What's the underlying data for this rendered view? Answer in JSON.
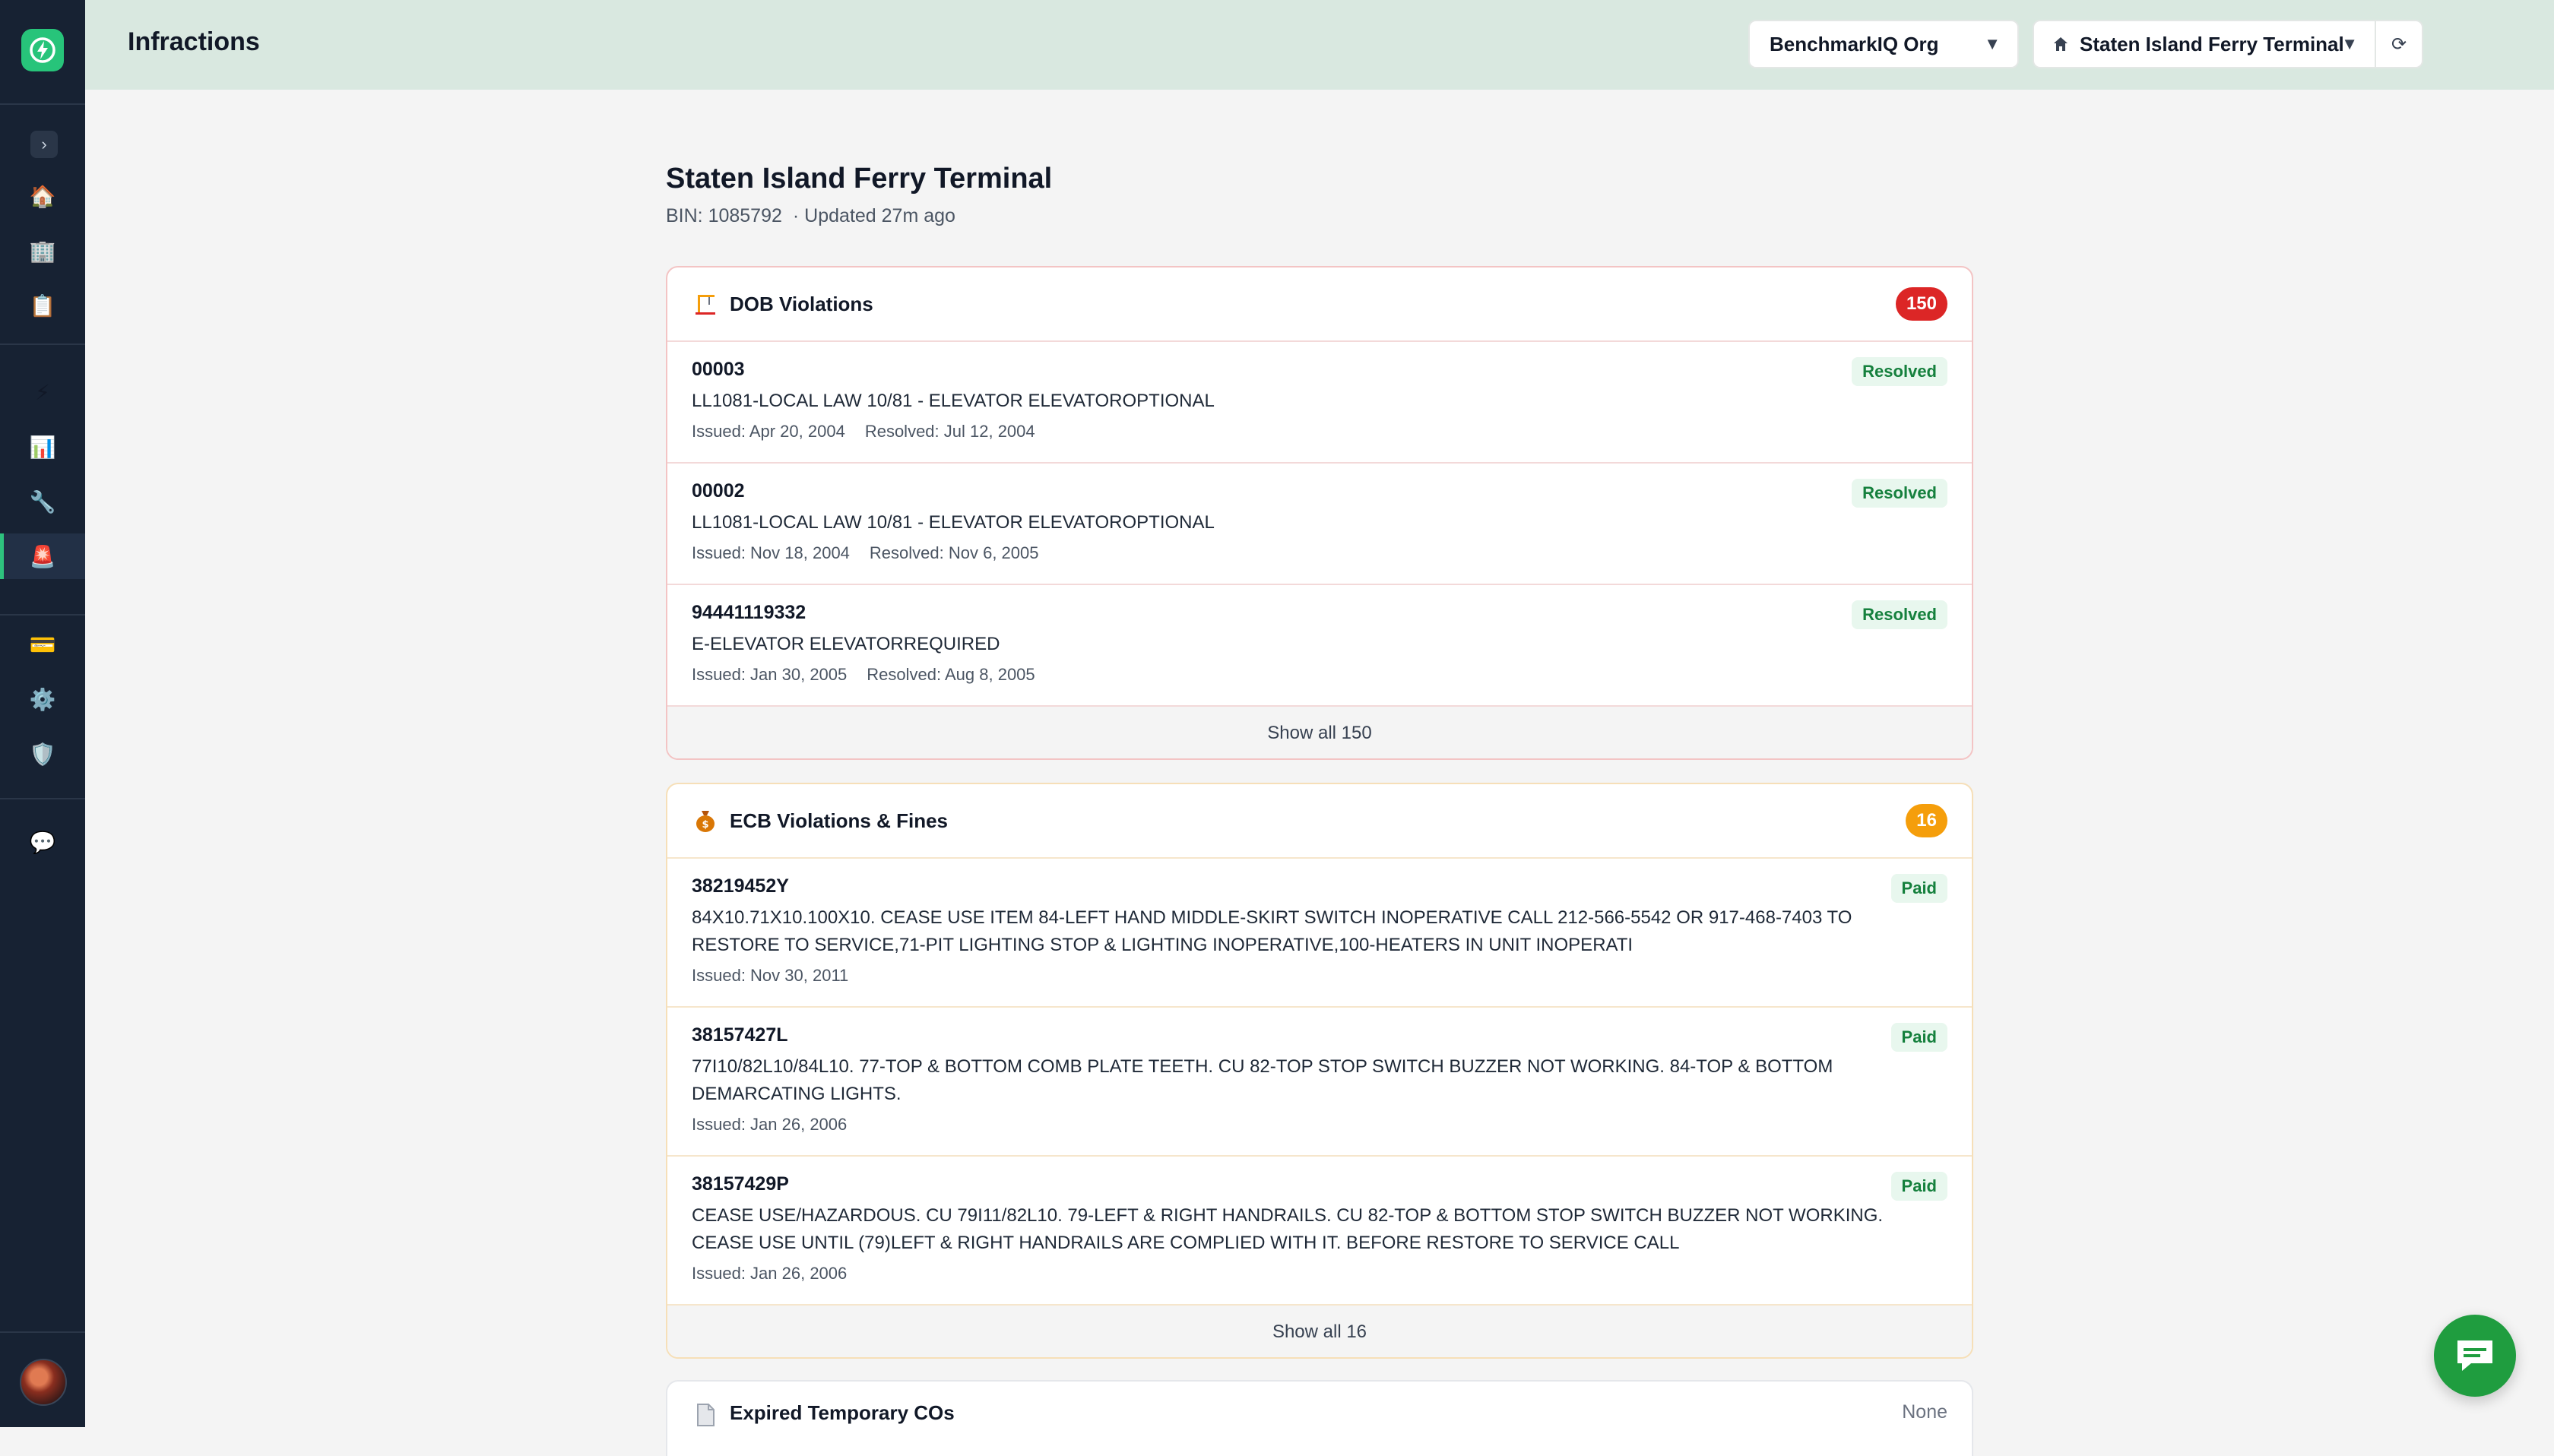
{
  "app": {
    "page_title": "Infractions",
    "org_select": "BenchmarkIQ Org",
    "site_select": "Staten Island Ferry Terminal",
    "refresh_icon": "⟳"
  },
  "sidebar": {
    "items": [
      {
        "name": "home-icon",
        "glyph": "🏠"
      },
      {
        "name": "buildings-icon",
        "glyph": "🏢"
      },
      {
        "name": "clipboard-icon",
        "glyph": "📋"
      },
      {
        "name": "energy-icon",
        "glyph": "⚡"
      },
      {
        "name": "analytics-icon",
        "glyph": "📊"
      },
      {
        "name": "tools-icon",
        "glyph": "🔧"
      },
      {
        "name": "infractions-icon",
        "glyph": "🚨"
      },
      {
        "name": "billing-icon",
        "glyph": "💳"
      },
      {
        "name": "settings-icon",
        "glyph": "⚙️"
      },
      {
        "name": "shield-icon",
        "glyph": "🛡️"
      },
      {
        "name": "chat-icon",
        "glyph": "💬"
      }
    ],
    "toggle": "›"
  },
  "building": {
    "name": "Staten Island Ferry Terminal",
    "bin": "BIN: 1085792",
    "updated": "· Updated 27m ago"
  },
  "dob": {
    "title": "DOB Violations",
    "count": "150",
    "rows": [
      {
        "id": "00003",
        "desc": "LL1081-LOCAL LAW 10/81 - ELEVATOR ELEVATOROPTIONAL",
        "issued": "Issued: Apr 20, 2004",
        "resolved": "Resolved: Jul 12, 2004",
        "status": "Resolved"
      },
      {
        "id": "00002",
        "desc": "LL1081-LOCAL LAW 10/81 - ELEVATOR ELEVATOROPTIONAL",
        "issued": "Issued: Nov 18, 2004",
        "resolved": "Resolved: Nov 6, 2005",
        "status": "Resolved"
      },
      {
        "id": "94441119332",
        "desc": "E-ELEVATOR ELEVATORREQUIRED",
        "issued": "Issued: Jan 30, 2005",
        "resolved": "Resolved: Aug 8, 2005",
        "status": "Resolved"
      }
    ],
    "show_all": "Show all 150"
  },
  "ecb": {
    "title": "ECB Violations & Fines",
    "count": "16",
    "rows": [
      {
        "id": "38219452Y",
        "desc": "84X10.71X10.100X10. CEASE USE ITEM 84-LEFT HAND MIDDLE-SKIRT SWITCH INOPERATIVE CALL 212-566-5542 OR 917-468-7403 TO RESTORE TO SERVICE,71-PIT LIGHTING STOP & LIGHTING INOPERATIVE,100-HEATERS IN UNIT INOPERATI",
        "issued": "Issued: Nov 30, 2011",
        "status": "Paid"
      },
      {
        "id": "38157427L",
        "desc": "77I10/82L10/84L10. 77-TOP & BOTTOM COMB PLATE TEETH. CU 82-TOP STOP SWITCH BUZZER NOT WORKING. 84-TOP & BOTTOM DEMARCATING LIGHTS.",
        "issued": "Issued: Jan 26, 2006",
        "status": "Paid"
      },
      {
        "id": "38157429P",
        "desc": "CEASE USE/HAZARDOUS. CU 79I11/82L10. 79-LEFT & RIGHT HANDRAILS. CU 82-TOP & BOTTOM STOP SWITCH BUZZER NOT WORKING. CEASE USE UNTIL (79)LEFT & RIGHT HANDRAILS ARE COMPLIED WITH IT. BEFORE RESTORE TO SERVICE CALL",
        "issued": "Issued: Jan 26, 2006",
        "status": "Paid"
      }
    ],
    "show_all": "Show all 16"
  },
  "tco": {
    "title": "Expired Temporary COs",
    "status": "None"
  },
  "colors": {
    "sidebar_bg": "#172233",
    "header_bg": "#d9e8e0",
    "accent_green": "#2ec27e",
    "badge_red": "#dc2626",
    "badge_orange": "#f59e0b",
    "status_green": "#15803d"
  }
}
